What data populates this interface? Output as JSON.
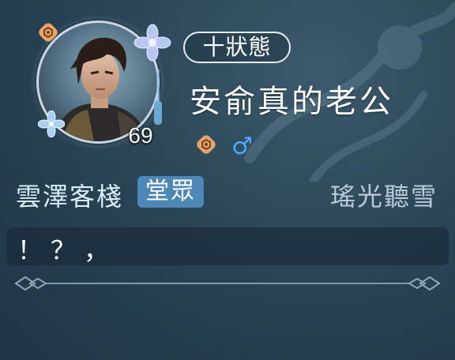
{
  "profile": {
    "level": "69",
    "status": "十狀態",
    "name": "安俞真的老公",
    "gender_symbol": "♂",
    "guild_name": "雲澤客棧",
    "guild_role": "堂眾",
    "server": "瑤光聽雪",
    "signature": "！？，"
  },
  "colors": {
    "gender": "#4ea7ff",
    "role_badge": "#4d87b8",
    "badge_icon": "#e8a56a"
  },
  "icons": {
    "corner_badge": "clan-emblem-icon",
    "small_badge": "clan-emblem-icon",
    "gender": "male-icon"
  }
}
